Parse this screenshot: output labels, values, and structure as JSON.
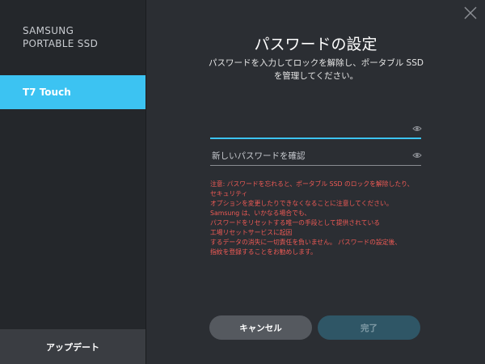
{
  "sidebar": {
    "brand_line1": "SAMSUNG",
    "brand_line2": "PORTABLE SSD",
    "device_label": "T7 Touch",
    "update_label": "アップデート"
  },
  "main": {
    "title": "パスワードの設定",
    "subtitle_line1": "パスワードを入力してロックを解除し、ポータブル SSD",
    "subtitle_line2": "を管理してください。",
    "password_field": {
      "value": "",
      "placeholder": ""
    },
    "confirm_field": {
      "value": "",
      "placeholder": "新しいパスワードを確認"
    },
    "warning_lines": [
      "注意: パスワードを忘れると、ポータブル SSD のロックを解除したり、",
      "セキュリティ",
      "オプションを変更したりできなくなることに注意してください。",
      "Samsung は、いかなる場合でも、",
      "パスワードをリセットする唯一の手段として提供されている",
      "工場リセットサービスに起因",
      "するデータの消失に一切責任を負いません。 パスワードの設定後、",
      "指紋を登録することをお勧めします。"
    ],
    "cancel_label": "キャンセル",
    "done_label": "完了"
  },
  "colors": {
    "accent": "#3cc3f2",
    "warning": "#ef5a55",
    "background": "#2b2e33",
    "sidebar": "#24272b"
  }
}
